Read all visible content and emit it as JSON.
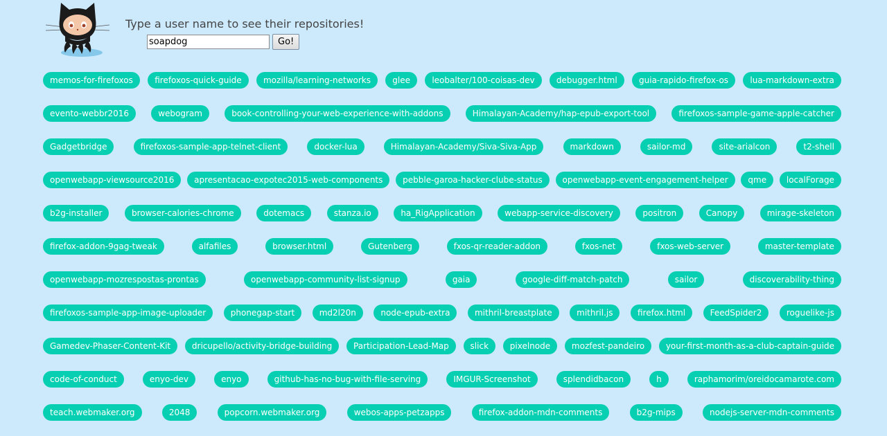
{
  "header": {
    "prompt": "Type a user name to see their repositories!",
    "username_value": "soapdog",
    "go_label": "Go!"
  },
  "repo_rows": [
    [
      "memos-for-firefoxos",
      "firefoxos-quick-guide",
      "mozilla/learning-networks",
      "glee",
      "leobalter/100-coisas-dev",
      "debugger.html",
      "guia-rapido-firefox-os",
      "lua-markdown-extra"
    ],
    [
      "evento-webbr2016",
      "webogram",
      "book-controlling-your-web-experience-with-addons",
      "Himalayan-Academy/hap-epub-export-tool",
      "firefoxos-sample-game-apple-catcher"
    ],
    [
      "Gadgetbridge",
      "firefoxos-sample-app-telnet-client",
      "docker-lua",
      "Himalayan-Academy/Siva-Siva-App",
      "markdown",
      "sailor-md",
      "site-arialcon",
      "t2-shell"
    ],
    [
      "openwebapp-viewsource2016",
      "apresentacao-expotec2015-web-components",
      "pebble-garoa-hacker-clube-status",
      "openwebapp-event-engagement-helper",
      "qme",
      "localForage"
    ],
    [
      "b2g-installer",
      "browser-calories-chrome",
      "dotemacs",
      "stanza.io",
      "ha_RigApplication",
      "webapp-service-discovery",
      "positron",
      "Canopy",
      "mirage-skeleton"
    ],
    [
      "firefox-addon-9gag-tweak",
      "alfafiles",
      "browser.html",
      "Gutenberg",
      "fxos-qr-reader-addon",
      "fxos-net",
      "fxos-web-server",
      "master-template"
    ],
    [
      "openwebapp-mozrespostas-prontas",
      "openwebapp-community-list-signup",
      "gaia",
      "google-diff-match-patch",
      "sailor",
      "discoverability-thing"
    ],
    [
      "firefoxos-sample-app-image-uploader",
      "phonegap-start",
      "md2l20n",
      "node-epub-extra",
      "mithril-breastplate",
      "mithril.js",
      "firefox.html",
      "FeedSpider2",
      "roguelike-js"
    ],
    [
      "Gamedev-Phaser-Content-Kit",
      "dricupello/activity-bridge-building",
      "Participation-Lead-Map",
      "slick",
      "pixelnode",
      "mozfest-pandeiro",
      "your-first-month-as-a-club-captain-guide"
    ],
    [
      "code-of-conduct",
      "enyo-dev",
      "enyo",
      "github-has-no-bug-with-file-serving",
      "IMGUR-Screenshot",
      "splendidbacon",
      "h",
      "raphamorim/oreidocamarote.com"
    ],
    [
      "teach.webmaker.org",
      "2048",
      "popcorn.webmaker.org",
      "webos-apps-petzapps",
      "firefox-addon-mdn-comments",
      "b2g-mips",
      "nodejs-server-mdn-comments"
    ]
  ],
  "colors": {
    "background": "#cdeafd",
    "pill": "#07cfb1",
    "pill_text": "#ffffff"
  },
  "icons": {
    "logo": "octocat-icon"
  }
}
